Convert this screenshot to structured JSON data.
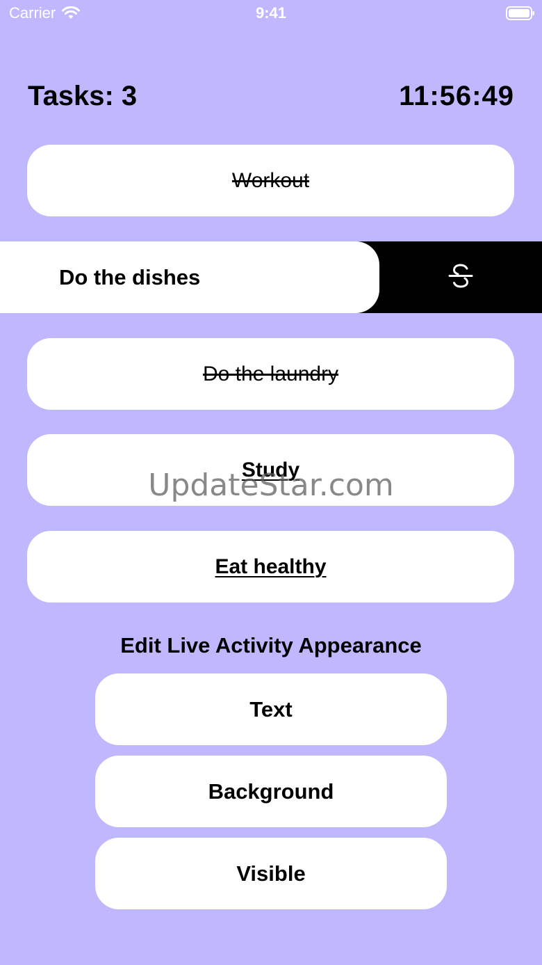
{
  "status_bar": {
    "carrier": "Carrier",
    "time": "9:41",
    "icons": [
      "wifi-icon",
      "battery-icon"
    ]
  },
  "header": {
    "tasks_label": "Tasks: 3",
    "clock": "11:56:49"
  },
  "tasks": [
    {
      "label": "Workout",
      "style": "strikethrough"
    },
    {
      "label": "Do the dishes",
      "style": "bold",
      "swiped": true
    },
    {
      "label": "Do the laundry",
      "style": "strikethrough"
    },
    {
      "label": "Study",
      "style": "bold-underline"
    },
    {
      "label": "Eat healthy",
      "style": "bold-underline"
    }
  ],
  "swipe_action": {
    "icon": "strikethrough-icon",
    "color": "#000000"
  },
  "appearance": {
    "title": "Edit Live Activity Appearance",
    "buttons": [
      {
        "label": "Text"
      },
      {
        "label": "Background"
      },
      {
        "label": "Visible"
      }
    ]
  },
  "watermark": "UpdateStar.com",
  "colors": {
    "background": "#c0b8ff",
    "card": "#ffffff",
    "text": "#000000"
  }
}
